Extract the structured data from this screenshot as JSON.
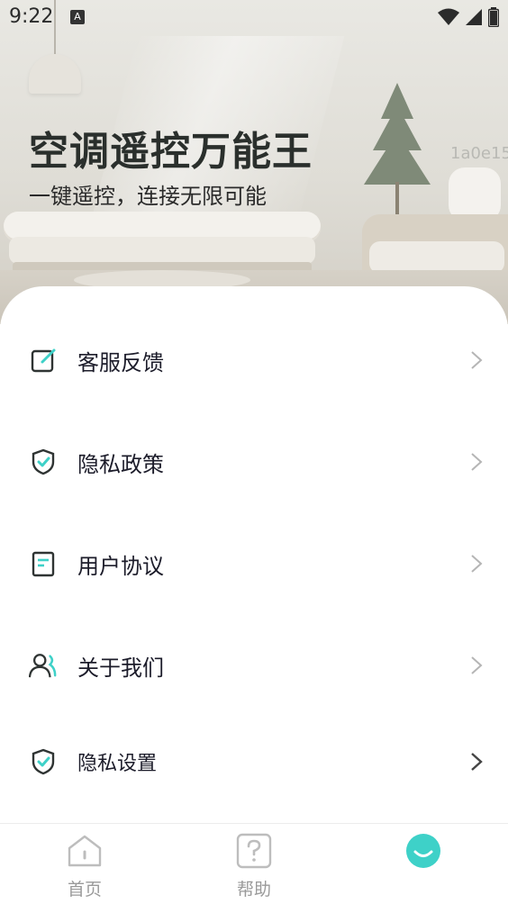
{
  "status_bar": {
    "time": "9:22",
    "badge": "A"
  },
  "hero": {
    "title": "空调遥控万能王",
    "subtitle": "一键遥控，连接无限可能",
    "code": "1a0e15"
  },
  "menu": {
    "items": [
      {
        "label": "客服反馈",
        "icon": "edit-icon"
      },
      {
        "label": "隐私政策",
        "icon": "shield-check-icon"
      },
      {
        "label": "用户协议",
        "icon": "document-icon"
      },
      {
        "label": "关于我们",
        "icon": "user-icon"
      },
      {
        "label": "隐私设置",
        "icon": "shield-check-icon"
      }
    ]
  },
  "tabbar": {
    "tabs": [
      {
        "label": "首页",
        "icon": "home-icon"
      },
      {
        "label": "帮助",
        "icon": "help-icon"
      },
      {
        "label": "",
        "icon": "smile-icon",
        "active": true
      }
    ]
  },
  "colors": {
    "accent": "#3ed1c8",
    "icon_dark": "#2f3433",
    "tab_inactive": "#9a9a9a"
  }
}
